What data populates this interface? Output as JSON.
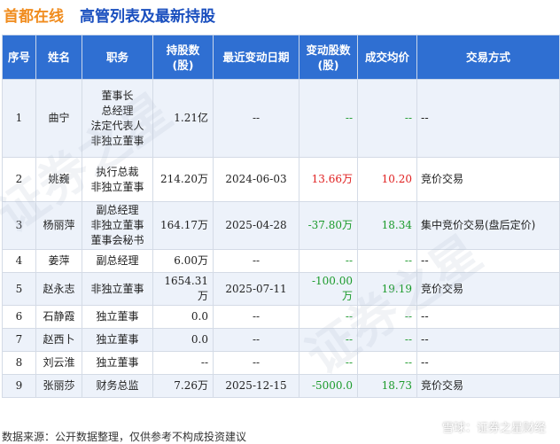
{
  "header": {
    "brand": "首都在线",
    "title": "高管列表及最新持股"
  },
  "table": {
    "columns": [
      "序号",
      "姓名",
      "职务",
      "持股数\n(股)",
      "最近变动日期",
      "变动股数\n(股)",
      "成交均价",
      "交易方式"
    ],
    "rows": [
      {
        "seq": "1",
        "name": "曲宁",
        "role": [
          "董事长",
          "总经理",
          "法定代表人",
          "非独立董事"
        ],
        "shares": "1.21亿",
        "date": "--",
        "change": "--",
        "price": "--",
        "method": "--"
      },
      {
        "seq": "2",
        "name": "姚巍",
        "role": [
          "执行总裁",
          "非独立董事"
        ],
        "shares": "214.20万",
        "date": "2024-06-03",
        "change": "13.66万",
        "price": "10.20",
        "method": "竞价交易"
      },
      {
        "seq": "3",
        "name": "杨丽萍",
        "role": [
          "副总经理",
          "非独立董事",
          "董事会秘书"
        ],
        "shares": "164.17万",
        "date": "2025-04-28",
        "change": "-37.80万",
        "price": "18.34",
        "method": "集中竞价交易(盘后定价)"
      },
      {
        "seq": "4",
        "name": "姜萍",
        "role": [
          "副总经理"
        ],
        "shares": "6.00万",
        "date": "--",
        "change": "--",
        "price": "--",
        "method": "--"
      },
      {
        "seq": "5",
        "name": "赵永志",
        "role": [
          "非独立董事"
        ],
        "shares": "1654.31万",
        "date": "2025-07-11",
        "change": "-100.00万",
        "price": "19.19",
        "method": "竞价交易"
      },
      {
        "seq": "6",
        "name": "石静霞",
        "role": [
          "独立董事"
        ],
        "shares": "0.0",
        "date": "--",
        "change": "--",
        "price": "--",
        "method": "--"
      },
      {
        "seq": "7",
        "name": "赵西卜",
        "role": [
          "独立董事"
        ],
        "shares": "0.0",
        "date": "--",
        "change": "--",
        "price": "--",
        "method": "--"
      },
      {
        "seq": "8",
        "name": "刘云淮",
        "role": [
          "独立董事"
        ],
        "shares": "--",
        "date": "--",
        "change": "--",
        "price": "--",
        "method": "--"
      },
      {
        "seq": "9",
        "name": "张丽莎",
        "role": [
          "财务总监"
        ],
        "shares": "7.26万",
        "date": "2025-12-15",
        "change": "-5000.0",
        "price": "18.73",
        "method": "竞价交易"
      }
    ]
  },
  "footer": {
    "source": "数据来源：公开数据整理，仅供参考不构成投资建议",
    "credit": "雪球：证券之星财经"
  },
  "watermark": [
    "证券之星",
    "证券之星"
  ],
  "colors": {
    "brand": "#f08c1e",
    "title": "#1a4fbf",
    "header_bg": "#2f6fd2",
    "positive": "#e02020",
    "negative": "#1a9a2a"
  }
}
